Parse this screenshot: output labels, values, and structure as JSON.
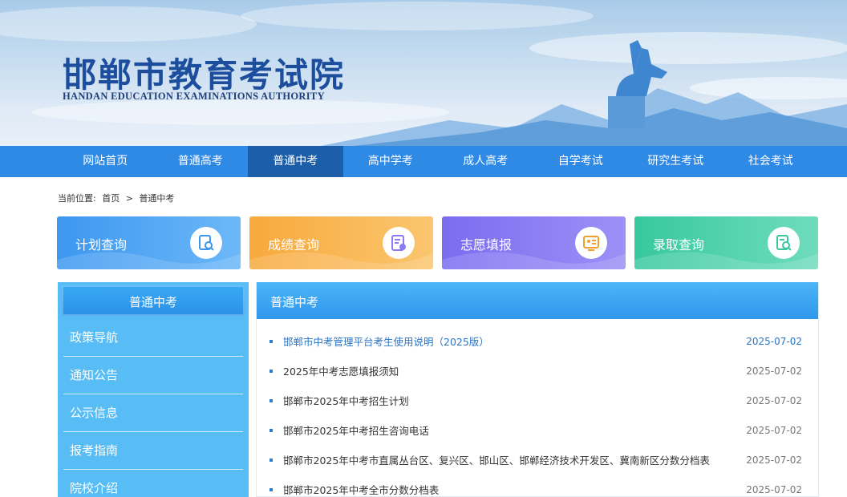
{
  "header": {
    "title_cn": "邯郸市教育考试院",
    "title_en": "HANDAN EDUCATION EXAMINATIONS AUTHORITY"
  },
  "nav": {
    "items": [
      "网站首页",
      "普通高考",
      "普通中考",
      "高中学考",
      "成人高考",
      "自学考试",
      "研究生考试",
      "社会考试"
    ],
    "active": "普通中考"
  },
  "breadcrumb": {
    "prefix": "当前位置:",
    "home": "首页",
    "separator": ">",
    "current": "普通中考"
  },
  "quick_cards": [
    {
      "label": "计划查询",
      "icon": "search-document-icon",
      "color": "#4aa3f2"
    },
    {
      "label": "成绩查询",
      "icon": "score-card-icon",
      "color": "#f8b24c"
    },
    {
      "label": "志愿填报",
      "icon": "form-icon",
      "color": "#8a7cf0"
    },
    {
      "label": "录取查询",
      "icon": "search-document-icon",
      "color": "#3fcfa8"
    }
  ],
  "sidebar": {
    "title": "普通中考",
    "items": [
      "政策导航",
      "通知公告",
      "公示信息",
      "报考指南",
      "院校介绍"
    ]
  },
  "main": {
    "title": "普通中考",
    "rows": [
      {
        "title": "邯郸市中考管理平台考生使用说明（2025版）",
        "date": "2025-07-02"
      },
      {
        "title": "2025年中考志愿填报须知",
        "date": "2025-07-02"
      },
      {
        "title": "邯郸市2025年中考招生计划",
        "date": "2025-07-02"
      },
      {
        "title": "邯郸市2025年中考招生咨询电话",
        "date": "2025-07-02"
      },
      {
        "title": "邯郸市2025年中考市直属丛台区、复兴区、邯山区、邯郸经济技术开发区、冀南新区分数分档表",
        "date": "2025-07-02"
      },
      {
        "title": "邯郸市2025年中考全市分数分档表",
        "date": "2025-07-02"
      }
    ]
  },
  "colors": {
    "nav_bg": "#2f8ae6",
    "nav_active": "#1c5fa8",
    "sidebar_bg": "#58bdf5",
    "link_blue": "#2a74c4"
  }
}
